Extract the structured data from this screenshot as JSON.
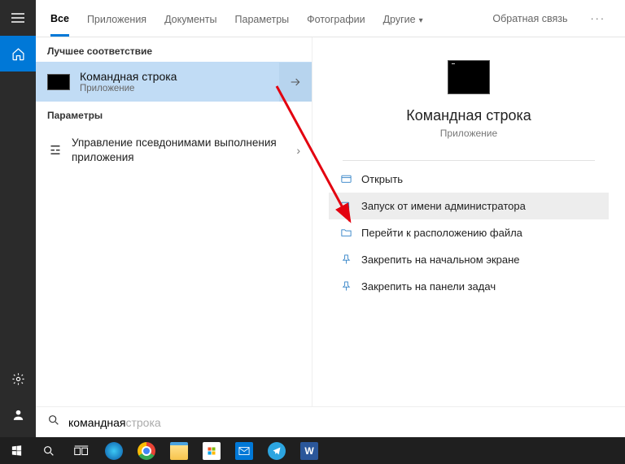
{
  "tabs": {
    "all": "Все",
    "apps": "Приложения",
    "docs": "Документы",
    "settings": "Параметры",
    "photos": "Фотографии",
    "other": "Другие",
    "feedback": "Обратная связь"
  },
  "sections": {
    "best_match": "Лучшее соответствие",
    "parameters": "Параметры"
  },
  "best_match": {
    "title": "Командная строка",
    "subtitle": "Приложение"
  },
  "param_item": {
    "text": "Управление псевдонимами выполнения приложения"
  },
  "detail": {
    "title": "Командная строка",
    "subtitle": "Приложение"
  },
  "actions": {
    "open": "Открыть",
    "run_admin": "Запуск от имени администратора",
    "open_location": "Перейти к расположению файла",
    "pin_start": "Закрепить на начальном экране",
    "pin_taskbar": "Закрепить на панели задач"
  },
  "search": {
    "typed": "командная",
    "completion": " строка"
  }
}
